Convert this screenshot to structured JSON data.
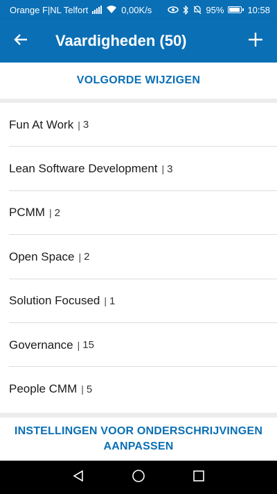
{
  "status_bar": {
    "carrier": "Orange F|NL Telfort",
    "speed": "0,00K/s",
    "battery": "95%",
    "time": "10:58"
  },
  "app_bar": {
    "title": "Vaardigheden (50)",
    "back_icon": "arrow-left-icon",
    "add_icon": "plus-icon"
  },
  "reorder_button": "VOLGORDE WIJZIGEN",
  "skills": [
    {
      "name": "Fun At Work",
      "sep": "|",
      "count": "3"
    },
    {
      "name": "Lean Software Development",
      "sep": "|",
      "count": "3"
    },
    {
      "name": "PCMM",
      "sep": "|",
      "count": "2"
    },
    {
      "name": "Open Space",
      "sep": "|",
      "count": "2"
    },
    {
      "name": "Solution Focused",
      "sep": "|",
      "count": "1"
    },
    {
      "name": "Governance",
      "sep": "|",
      "count": "15"
    },
    {
      "name": "People CMM",
      "sep": "|",
      "count": "5"
    }
  ],
  "settings_button": {
    "line1": "INSTELLINGEN VOOR ONDERSCHRIJVINGEN",
    "line2": "AANPASSEN"
  },
  "colors": {
    "primary": "#0a6fb5",
    "text": "#1a1a1a",
    "divider": "#dcdcdc"
  }
}
